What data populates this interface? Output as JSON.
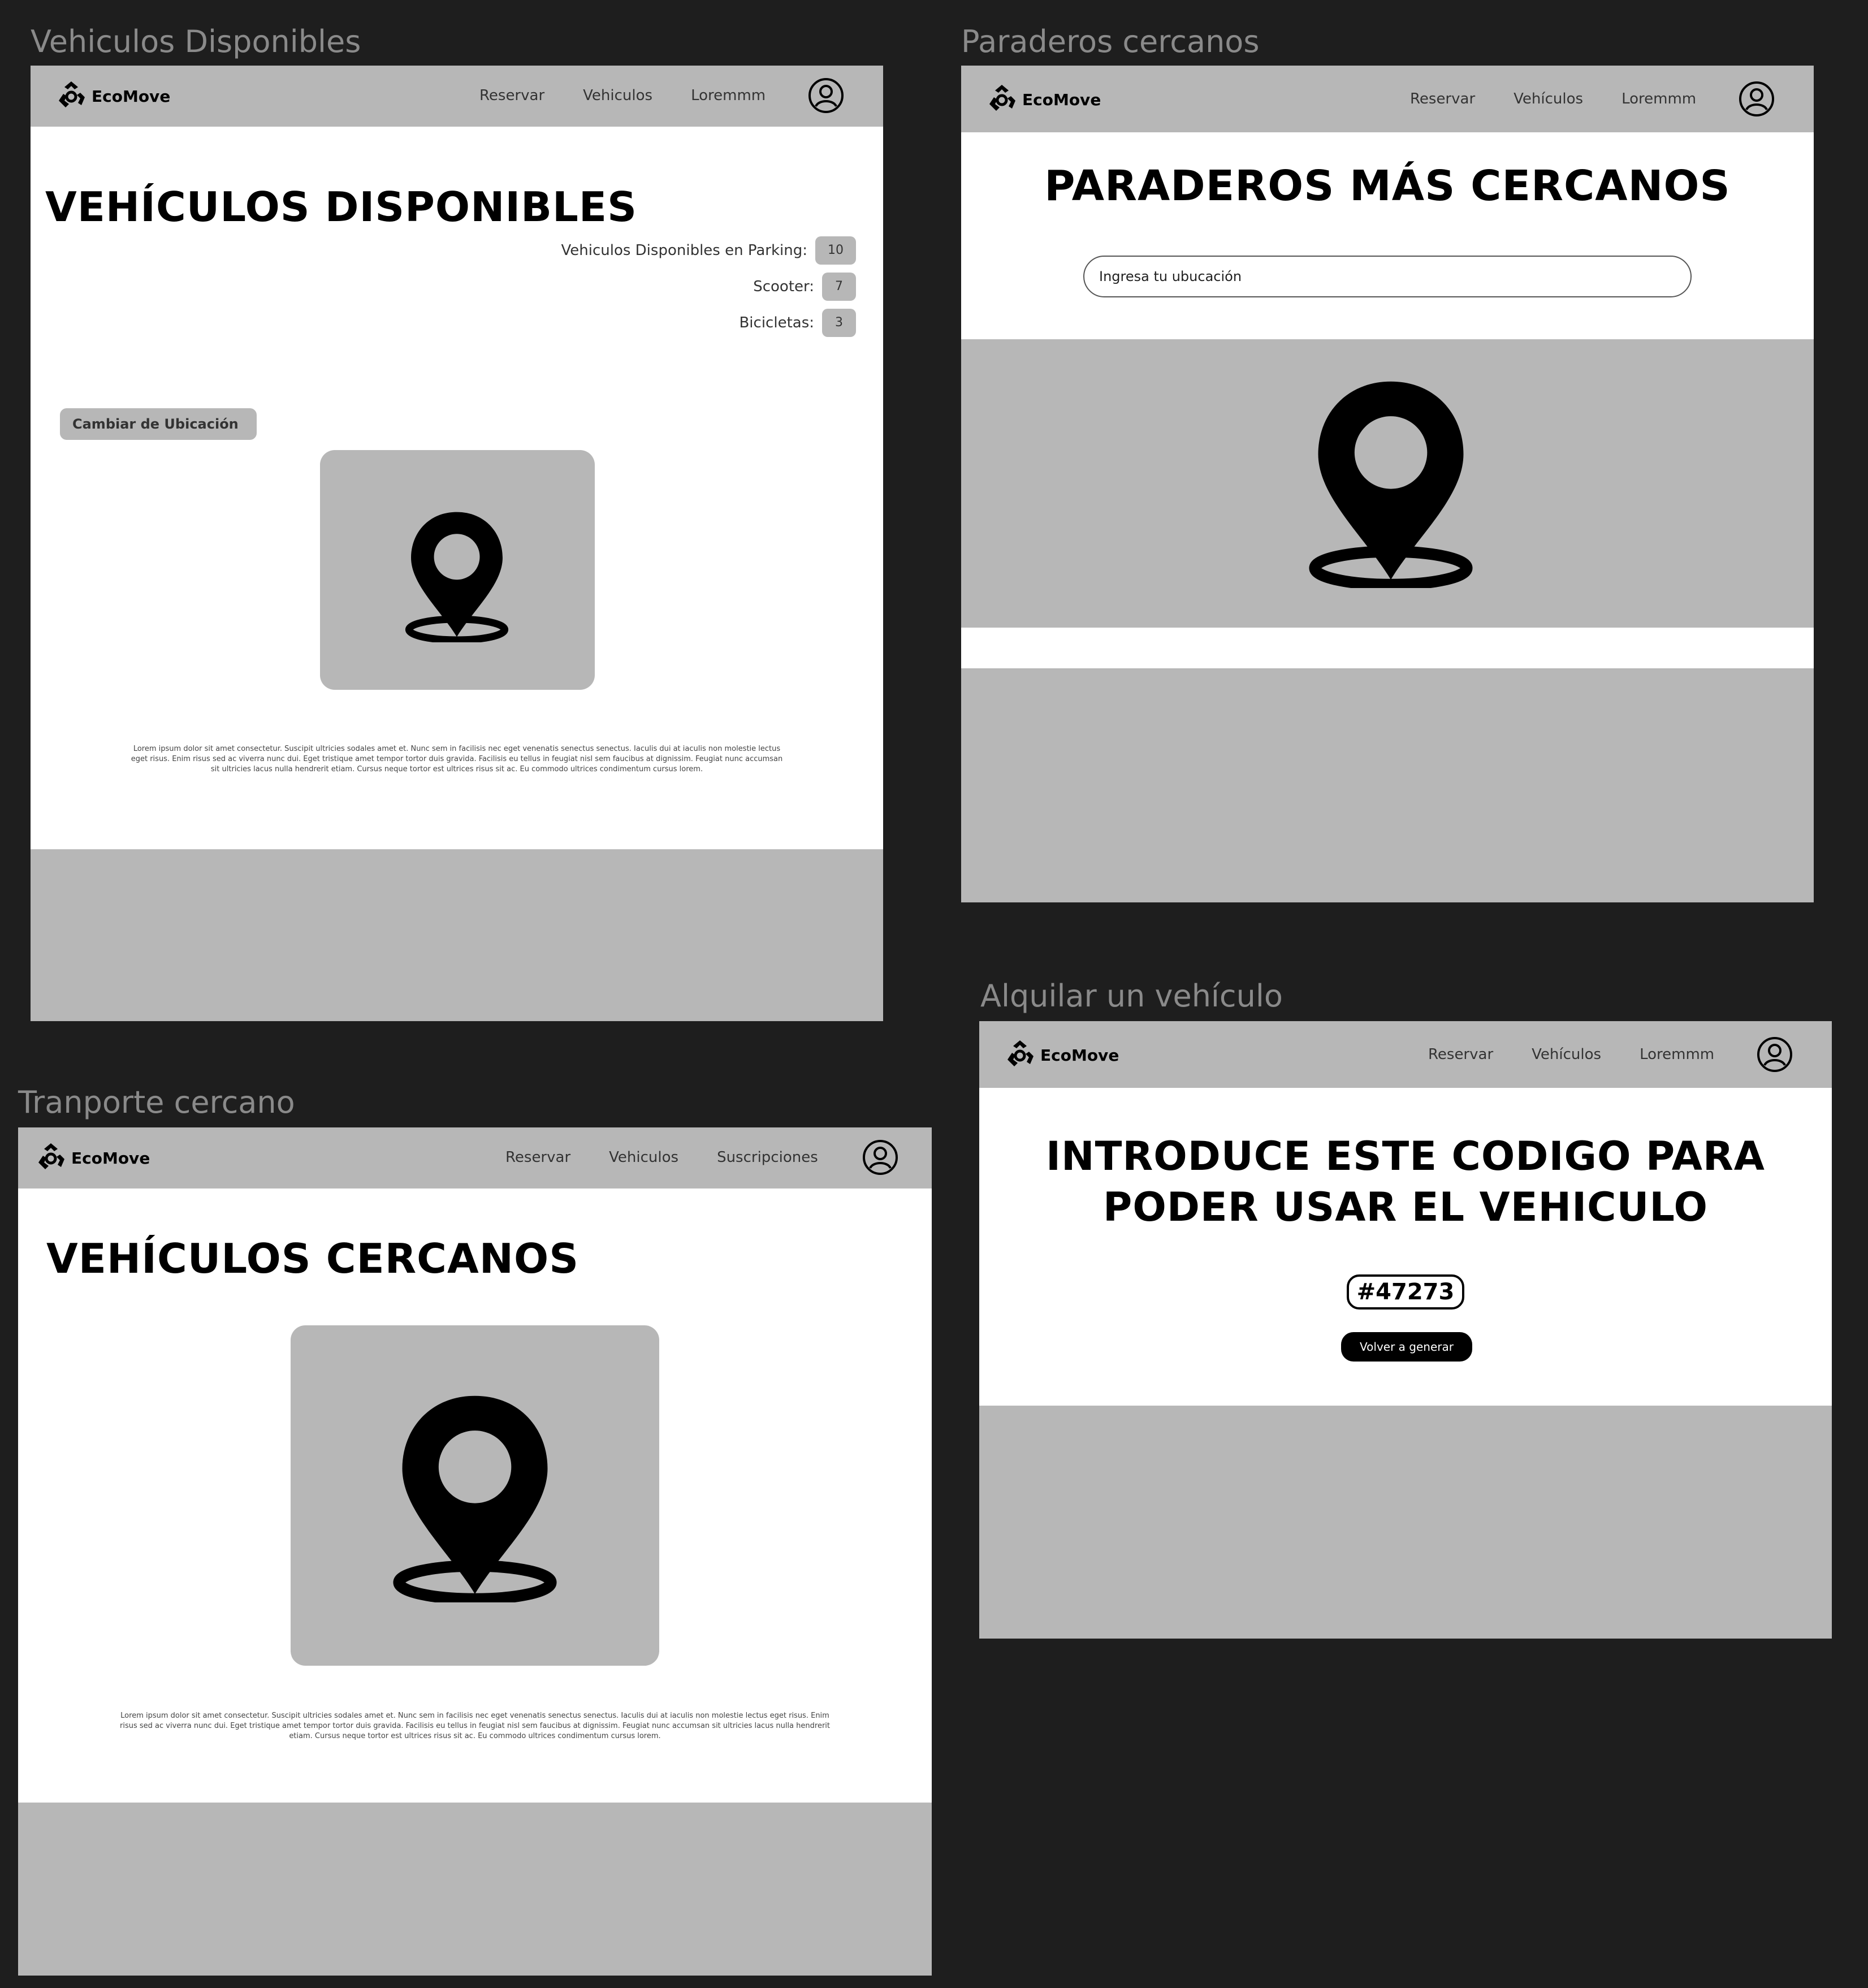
{
  "brand": {
    "name": "EcoMove"
  },
  "icons": {
    "logo": "recycle-logo-icon",
    "avatar": "user-avatar-icon",
    "map": "location-pin-icon"
  },
  "colors": {
    "canvas": "#1e1e1e",
    "frame_grey": "#b7b7b7",
    "label": "#8a8a8a"
  },
  "frames": {
    "vehiculos_disponibles": {
      "label": "Vehiculos Disponibles",
      "nav": [
        "Reservar",
        "Vehiculos",
        "Loremmm"
      ],
      "title": "VEHÍCULOS DISPONIBLES",
      "counts": [
        {
          "label": "Vehiculos Disponibles en Parking:",
          "value": "10"
        },
        {
          "label": "Scooter:",
          "value": "7"
        },
        {
          "label": "Bicicletas:",
          "value": "3"
        }
      ],
      "change_location": "Cambiar de Ubicación",
      "lorem": "Lorem ipsum dolor sit amet consectetur. Suscipit ultricies sodales amet et. Nunc sem in facilisis nec eget venenatis senectus senectus. Iaculis dui at iaculis non molestie lectus eget risus. Enim risus sed ac viverra nunc dui. Eget tristique amet tempor tortor duis gravida. Facilisis eu tellus in feugiat nisl sem faucibus at dignissim. Feugiat nunc accumsan sit ultricies lacus nulla hendrerit etiam. Cursus neque tortor est ultrices risus sit ac. Eu commodo ultrices condimentum cursus lorem."
    },
    "paraderos": {
      "label": "Paraderos cercanos",
      "nav": [
        "Reservar",
        "Vehículos",
        "Loremmm"
      ],
      "title": "PARADEROS MÁS CERCANOS",
      "search_placeholder": "Ingresa tu ubucación"
    },
    "transporte": {
      "label": "Tranporte cercano",
      "nav": [
        "Reservar",
        "Vehiculos",
        "Suscripciones"
      ],
      "title": "VEHÍCULOS CERCANOS",
      "lorem": "Lorem ipsum dolor sit amet consectetur. Suscipit ultricies sodales amet et. Nunc sem in facilisis nec eget venenatis senectus senectus. Iaculis dui at iaculis non molestie lectus eget risus. Enim risus sed ac viverra nunc dui. Eget tristique amet tempor tortor duis gravida. Facilisis eu tellus in feugiat nisl sem faucibus at dignissim. Feugiat nunc accumsan sit ultricies lacus nulla hendrerit etiam. Cursus neque tortor est ultrices risus sit ac. Eu commodo ultrices condimentum cursus lorem."
    },
    "alquilar": {
      "label": "Alquilar un vehículo",
      "nav": [
        "Reservar",
        "Vehículos",
        "Loremmm"
      ],
      "title_line1": "INTRODUCE ESTE CODIGO PARA",
      "title_line2": "PODER USAR EL VEHICULO",
      "code": "#47273",
      "regenerate": "Volver a generar"
    }
  }
}
